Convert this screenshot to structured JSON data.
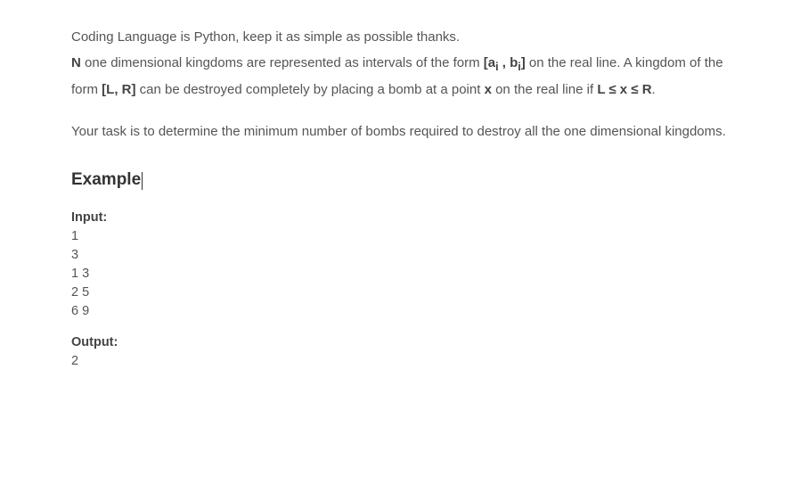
{
  "intro": {
    "line1": "Coding Language is  Python, keep it as simple as possible thanks.",
    "n": "N",
    "line2_after_n": " one dimensional kingdoms are represented as intervals of the form ",
    "interval1": "[a",
    "sub_i": "i",
    "interval_mid": " , b",
    "sub_i2": "i",
    "interval1_end": "]",
    "line2_end": " on the real line. A kingdom of the form ",
    "lr": "[L, R]",
    "line3_mid": " can be destroyed completely by placing a bomb at a point ",
    "x": "x",
    "line3_end": " on the real line if ",
    "cond": "L ≤ x ≤ R",
    "period": "."
  },
  "task": "Your task is to determine the minimum number of bombs required to destroy all the one dimensional kingdoms.",
  "example_heading": "Example",
  "input_label": "Input:",
  "input_lines": [
    "1",
    "3",
    "1 3",
    "2 5",
    "6 9"
  ],
  "output_label": "Output:",
  "output_lines": [
    "2"
  ]
}
